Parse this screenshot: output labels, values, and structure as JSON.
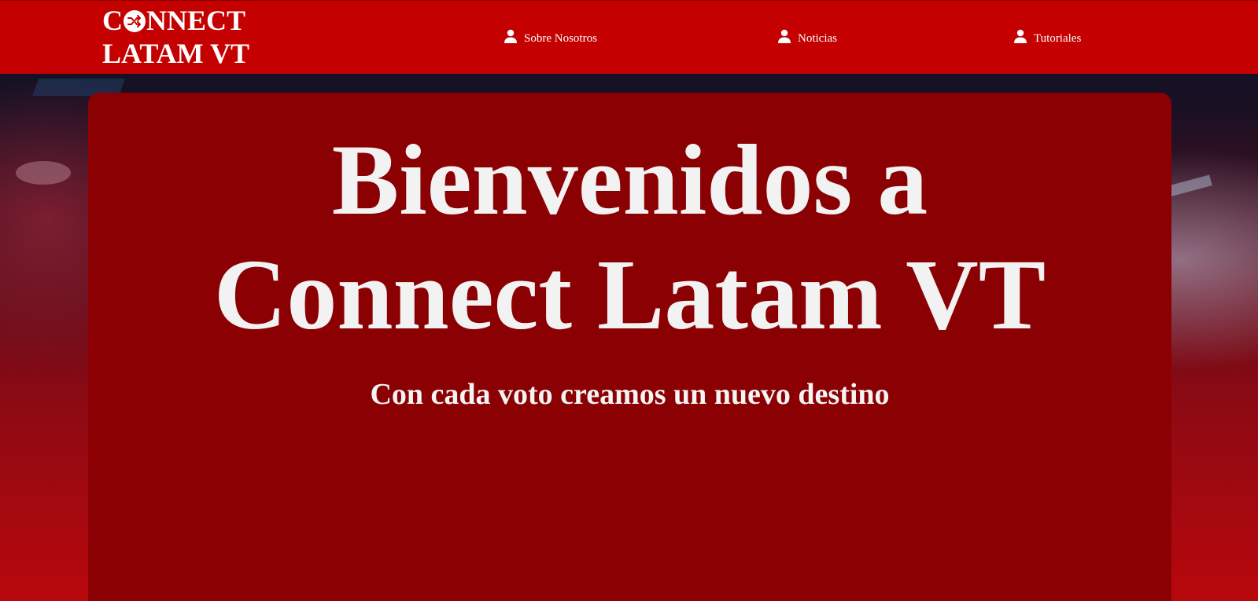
{
  "brand": {
    "line1_prefix": "C",
    "line1_suffix": "NNECT",
    "line2": "LATAM VT",
    "logo_icon": "shuffle-arrows-icon"
  },
  "nav": {
    "items": [
      {
        "label": "Sobre Nosotros",
        "icon": "user-icon"
      },
      {
        "label": "Noticias",
        "icon": "user-icon"
      },
      {
        "label": "Tutoriales",
        "icon": "user-icon"
      }
    ]
  },
  "hero": {
    "title_line1": "Bienvenidos a",
    "title_line2": "Connect Latam VT",
    "subtitle": "Con cada voto creamos un nuevo destino"
  },
  "colors": {
    "header_bg": "#c40000",
    "hero_bg": "#8b0003",
    "text": "#f2f2f2"
  }
}
